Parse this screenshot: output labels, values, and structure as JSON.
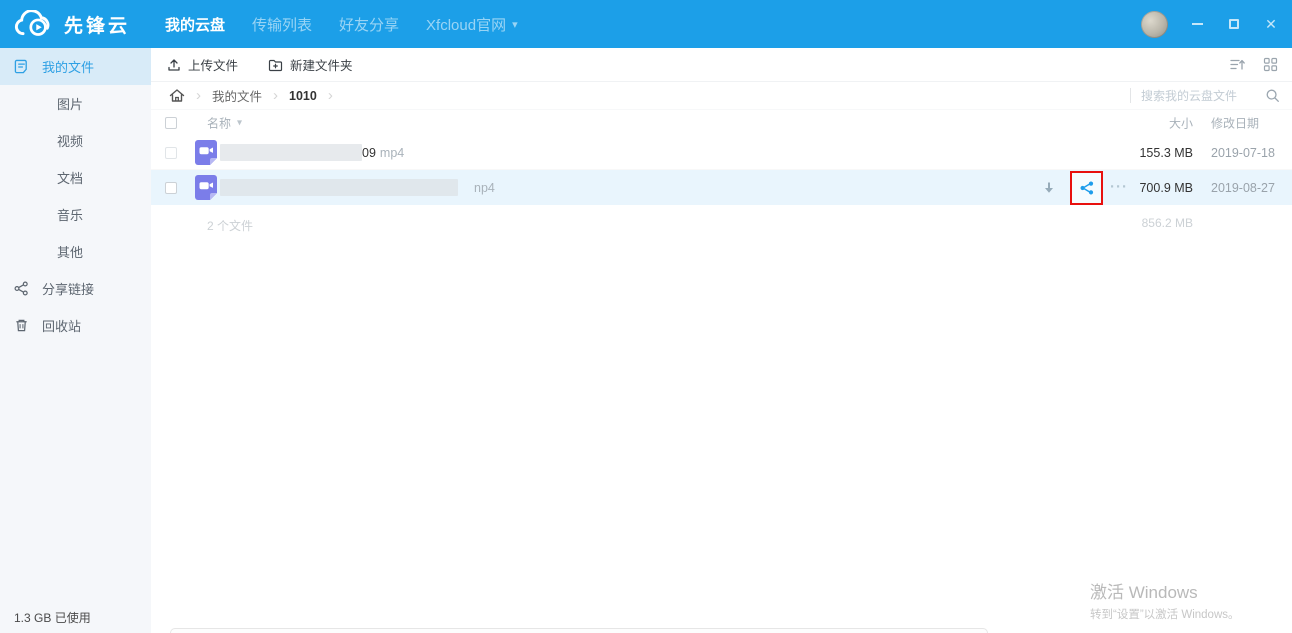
{
  "topbar": {
    "brand": "先锋云",
    "tabs": [
      {
        "label": "我的云盘",
        "active": true
      },
      {
        "label": "传输列表",
        "active": false
      },
      {
        "label": "好友分享",
        "active": false
      },
      {
        "label": "Xfcloud官网",
        "active": false,
        "has_dropdown": true
      }
    ]
  },
  "sidebar": {
    "items": [
      {
        "label": "我的文件",
        "icon": "file-icon",
        "active": true
      },
      {
        "label": "图片",
        "indent": true
      },
      {
        "label": "视频",
        "indent": true
      },
      {
        "label": "文档",
        "indent": true
      },
      {
        "label": "音乐",
        "indent": true
      },
      {
        "label": "其他",
        "indent": true
      },
      {
        "label": "分享链接",
        "icon": "share-nodes-icon"
      },
      {
        "label": "回收站",
        "icon": "trash-icon"
      }
    ],
    "usage": "1.3 GB 已使用"
  },
  "toolbar": {
    "upload_label": "上传文件",
    "new_folder_label": "新建文件夹"
  },
  "breadcrumb": {
    "items": [
      "我的文件",
      "1010"
    ]
  },
  "search": {
    "placeholder": "搜索我的云盘文件"
  },
  "table": {
    "headers": {
      "name": "名称",
      "size": "大小",
      "date": "修改日期"
    },
    "rows": [
      {
        "name_visible": "09",
        "ext": "mp4",
        "redacted": true,
        "size": "155.3 MB",
        "date": "2019-07-18",
        "selected": false
      },
      {
        "name_visible": "",
        "ext": "np4",
        "redacted": true,
        "size": "700.9 MB",
        "date": "2019-08-27",
        "selected": true,
        "actions": [
          "download",
          "share",
          "more"
        ],
        "annotation": "red box around share icon"
      }
    ],
    "summary": {
      "count": "2 个文件",
      "total_size": "856.2 MB"
    }
  },
  "watermark": {
    "line1": "激活 Windows",
    "line2": "转到“设置”以激活 Windows。"
  },
  "icons": {
    "chevron": "›",
    "caret_down": "▾",
    "close": "✕",
    "more": "···"
  },
  "colors": {
    "topbar": "#1c9fe8",
    "sidebar_active_bg": "#d8ebf8",
    "accent_blue": "#2ea0e4",
    "row_selected_bg": "#e9f5fd",
    "file_icon_purple": "#7b7de9",
    "share_icon_blue": "#1e9deb",
    "annotation_red": "#e8100e"
  }
}
